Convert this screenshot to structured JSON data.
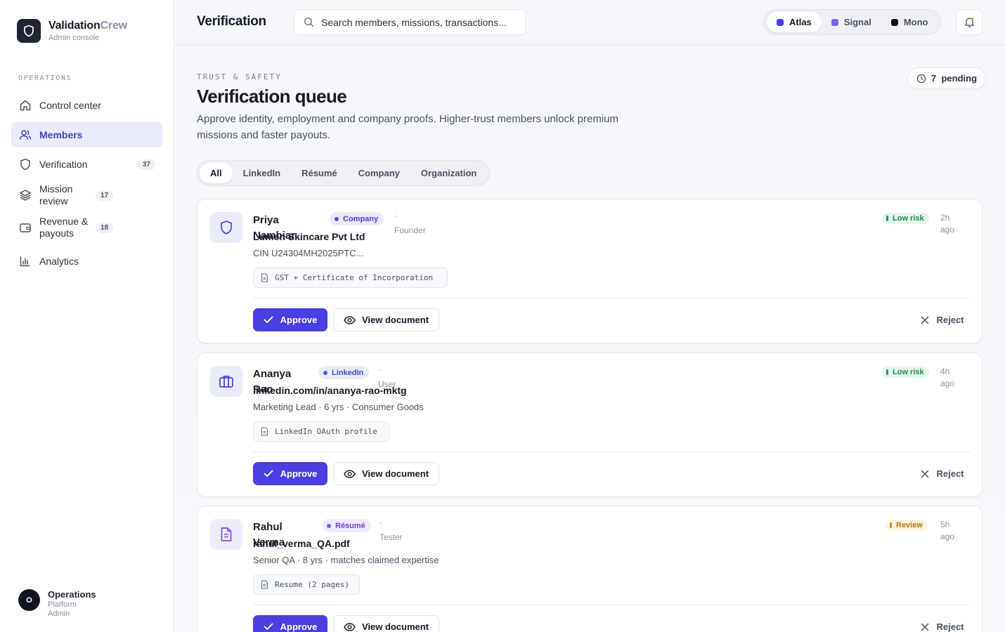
{
  "brand": {
    "name_primary": "Validation",
    "name_secondary": "Crew",
    "subtitle": "Admin console"
  },
  "sidebar": {
    "section_label": "OPERATIONS",
    "items": [
      {
        "label": "Control center",
        "icon": "home-icon",
        "badge": ""
      },
      {
        "label": "Members",
        "icon": "users-icon",
        "badge": "",
        "active": true
      },
      {
        "label": "Verification",
        "icon": "shield-icon",
        "badge": "37"
      },
      {
        "label": "Mission review",
        "icon": "layers-icon",
        "badge": "17"
      },
      {
        "label": "Revenue & payouts",
        "icon": "wallet-icon",
        "badge": "18"
      },
      {
        "label": "Analytics",
        "icon": "bar-chart-icon",
        "badge": ""
      }
    ],
    "user": {
      "initial": "O",
      "name": "Operations",
      "role": "Platform Admin"
    }
  },
  "header": {
    "title": "Verification",
    "search_placeholder": "Search members, missions, transactions...",
    "themes": [
      {
        "label": "Atlas",
        "color": "#4a3fe0",
        "active": true
      },
      {
        "label": "Signal",
        "color": "#7b61e8"
      },
      {
        "label": "Mono",
        "color": "#111111"
      }
    ],
    "notification_dot_color": "#f2994a"
  },
  "page": {
    "eyebrow": "TRUST & SAFETY",
    "title": "Verification queue",
    "description": "Approve identity, employment and company proofs. Higher-trust members unlock premium missions and faster payouts.",
    "pending_count": "7",
    "pending_label": "pending",
    "filters": [
      "All",
      "LinkedIn",
      "Résumé",
      "Company",
      "Organization"
    ],
    "active_filter": "All"
  },
  "actions": {
    "approve": "Approve",
    "view": "View document",
    "reject": "Reject"
  },
  "colors": {
    "accent": "#4a3fe0",
    "low_risk": "#1e8a4f",
    "review": "#b57509"
  },
  "queue": [
    {
      "name": "Priya Nambiar",
      "type": "Company",
      "separator": "·",
      "role": "Founder",
      "title": "Lumen Skincare Pvt Ltd",
      "subtitle": "CIN U24304MH2025PTC...",
      "document": "GST + Certificate of Incorporation",
      "risk": "Low risk",
      "age": "2h ago",
      "icon": "shield-icon"
    },
    {
      "name": "Ananya Rao",
      "type": "LinkedIn",
      "separator": "·",
      "role": "User",
      "title": "linkedin.com/in/ananya-rao-mktg",
      "subtitle": "Marketing Lead · 6 yrs · Consumer Goods",
      "document": "LinkedIn OAuth profile",
      "risk": "Low risk",
      "age": "4h ago",
      "icon": "briefcase-icon"
    },
    {
      "name": "Rahul Verma",
      "type": "Résumé",
      "separator": "·",
      "role": "Tester",
      "title": "rahul_verma_QA.pdf",
      "subtitle": "Senior QA · 8 yrs · matches claimed expertise",
      "document": "Resume (2 pages)",
      "risk": "Review",
      "age": "5h ago",
      "icon": "file-text-icon"
    }
  ]
}
